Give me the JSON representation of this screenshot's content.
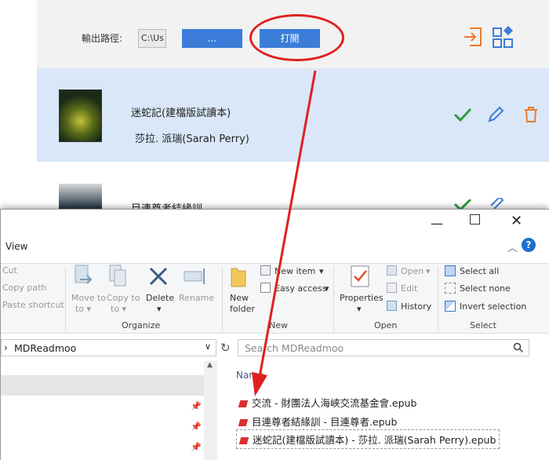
{
  "app": {
    "output_path_label": "輸出路徑:",
    "output_path_value": "C:\\Us",
    "browse_button": "...",
    "open_button": "打開",
    "books": [
      {
        "title": "迷蛇記(建檔版試讀本)",
        "author": "莎拉. 派瑞(Sarah Perry)"
      },
      {
        "title": "目連尊者結緣訓"
      }
    ]
  },
  "explorer": {
    "tab_view": "View",
    "clipboard": {
      "cut": "Cut",
      "copy_path": "Copy path",
      "paste_shortcut": "Paste shortcut"
    },
    "organize": {
      "move_to": "Move to",
      "copy_to": "Copy to",
      "delete": "Delete",
      "rename": "Rename",
      "group": "Organize"
    },
    "new": {
      "new_folder": "New folder",
      "new_item": "New item",
      "easy_access": "Easy access",
      "group": "New"
    },
    "open": {
      "properties": "Properties",
      "open": "Open",
      "edit": "Edit",
      "history": "History",
      "group": "Open"
    },
    "select": {
      "select_all": "Select all",
      "select_none": "Select none",
      "invert": "Invert selection",
      "group": "Select"
    },
    "address": "MDReadmoo",
    "search_placeholder": "Search MDReadmoo",
    "column_name": "Name",
    "files": [
      "交流 - 財團法人海峽交流基金會.epub",
      "目連尊者結緣訓 - 目連尊者.epub",
      "迷蛇記(建檔版試讀本) - 莎拉. 派瑞(Sarah Perry).epub"
    ]
  },
  "colors": {
    "accent": "#3b7dd8",
    "highlight": "#e02020",
    "orange": "#f07a2a",
    "check": "#2e9e3a"
  }
}
